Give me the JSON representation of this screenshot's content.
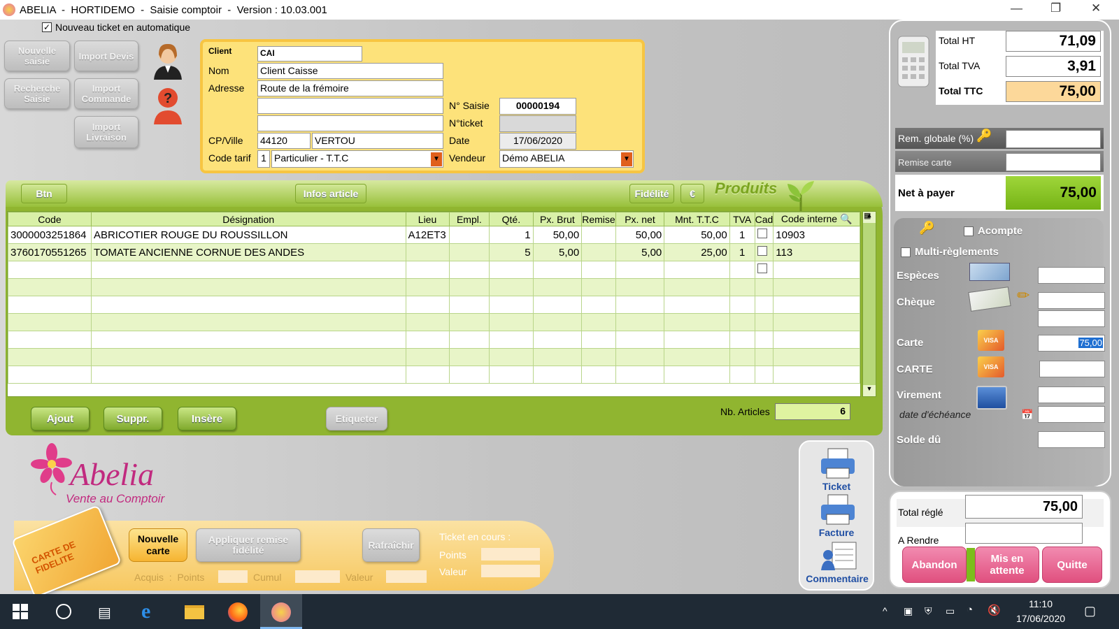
{
  "window": {
    "title": "ABELIA  -  HORTIDEMO  -  Saisie comptoir  -  Version : 10.03.001"
  },
  "auto_ticket": "Nouveau ticket en automatique",
  "left_buttons": {
    "nouvelle_saisie": "Nouvelle saisie",
    "import_devis": "Import Devis",
    "recherche_saisie": "Recherche Saisie",
    "import_commande": "Import Commande",
    "import_livraison": "Import Livraison"
  },
  "client": {
    "label_client": "Client",
    "client": "CAI",
    "label_nom": "Nom",
    "nom": "Client Caisse",
    "label_adresse": "Adresse",
    "adresse1": "Route de la frémoire",
    "adresse2": "",
    "adresse3": "",
    "label_cpville": "CP/Ville",
    "cp": "44120",
    "ville": "VERTOU",
    "label_code_tarif": "Code tarif",
    "code_tarif_num": "1",
    "code_tarif": "Particulier - T.T.C",
    "label_n_saisie": "N° Saisie",
    "n_saisie": "00000194",
    "label_n_ticket": "N°ticket",
    "n_ticket": "",
    "label_date": "Date",
    "date": "17/06/2020",
    "label_vendeur": "Vendeur",
    "vendeur": "Démo ABELIA"
  },
  "grid_toolbar": {
    "btn": "Btn",
    "infos_article": "Infos article",
    "fidelite": "Fidélité",
    "euro": "€",
    "produits": "Produits"
  },
  "grid": {
    "headers": [
      "Code",
      "Désignation",
      "Lieu",
      "Empl.",
      "Qté.",
      "Px. Brut",
      "Remise",
      "Px. net",
      "Mnt. T.T.C",
      "TVA",
      "Cad",
      "Code interne"
    ],
    "rows": [
      {
        "code": "3000003251864",
        "designation": "ABRICOTIER ROUGE DU ROUSSILLON",
        "lieu": "A12ET3",
        "empl": "",
        "qte": "1",
        "px_brut": "50,00",
        "remise": "",
        "px_net": "50,00",
        "mnt_ttc": "50,00",
        "tva": "1",
        "code_interne": "10903"
      },
      {
        "code": "3760170551265",
        "designation": "TOMATE ANCIENNE CORNUE DES ANDES",
        "lieu": "",
        "empl": "",
        "qte": "5",
        "px_brut": "5,00",
        "remise": "",
        "px_net": "5,00",
        "mnt_ttc": "25,00",
        "tva": "1",
        "code_interne": "113"
      }
    ]
  },
  "grid_actions": {
    "ajout": "Ajout",
    "suppr": "Suppr.",
    "insere": "Insère",
    "etiqueter": "Etiqueter",
    "nb_articles_label": "Nb. Articles",
    "nb_articles": "6"
  },
  "totals": {
    "total_ht_label": "Total HT",
    "total_ht": "71,09",
    "total_tva_label": "Total TVA",
    "total_tva": "3,91",
    "total_ttc_label": "Total TTC",
    "total_ttc": "75,00",
    "rem_globale_label": "Rem. globale (%)",
    "remise_carte_label": "Remise carte",
    "net_label": "Net à payer",
    "net": "75,00"
  },
  "payment": {
    "acompte": "Acompte",
    "multi": "Multi-règlements",
    "especes": "Espèces",
    "cheque": "Chèque",
    "carte": "Carte",
    "carte_value": "75,00",
    "carte2": "CARTE",
    "virement": "Virement",
    "echeance": "date d'échéance",
    "solde": "Solde dû"
  },
  "settle": {
    "total_regle_label": "Total réglé",
    "total_regle": "75,00",
    "a_rendre_label": "A Rendre",
    "abandon": "Abandon",
    "attente": "Mis en attente",
    "quitte": "Quitte"
  },
  "print": {
    "ticket": "Ticket",
    "facture": "Facture",
    "commentaire": "Commentaire"
  },
  "logo": {
    "name": "Abelia",
    "tagline": "Vente au Comptoir"
  },
  "loyalty": {
    "card_text": "CARTE DE FIDELITE",
    "nouvelle_carte": "Nouvelle carte",
    "appliquer": "Appliquer remise fidélité",
    "rafraichir": "Rafraîchir",
    "ticket_en_cours": "Ticket en cours :",
    "points": "Points",
    "valeur": "Valeur",
    "acquis": "Acquis  :  Points",
    "cumul": "Cumul",
    "valeur2": "Valeur"
  },
  "taskbar": {
    "time": "11:10",
    "date": "17/06/2020"
  },
  "colors": {
    "green": "#90b530",
    "yellow": "#fde27a",
    "pink": "#e0507f",
    "net_green": "#8cc21f"
  }
}
